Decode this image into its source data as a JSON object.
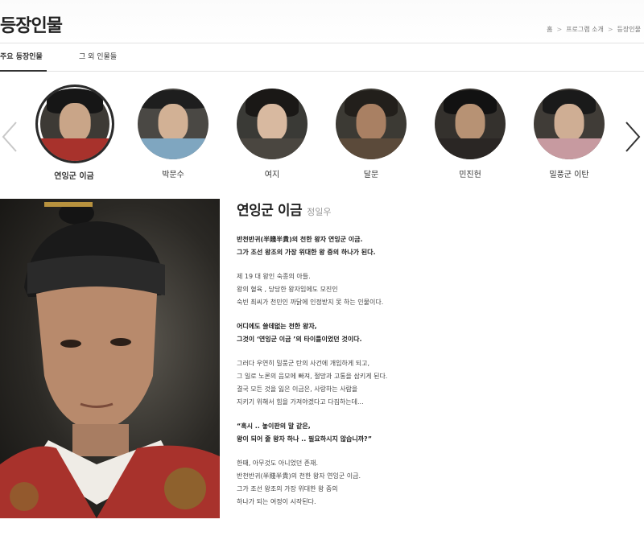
{
  "header": {
    "title": "등장인물",
    "breadcrumb": [
      "홈",
      "프로그램 소개",
      "등장인물"
    ],
    "breadcrumb_separator": ">"
  },
  "tabs": [
    {
      "label": "주요 등장인물",
      "active": true
    },
    {
      "label": "그 외 인물들",
      "active": false
    }
  ],
  "cast": [
    {
      "name": "연잉군 이금",
      "selected": true
    },
    {
      "name": "박문수",
      "selected": false
    },
    {
      "name": "여지",
      "selected": false
    },
    {
      "name": "달문",
      "selected": false
    },
    {
      "name": "민진헌",
      "selected": false
    },
    {
      "name": "밀풍군 이탄",
      "selected": false
    }
  ],
  "carousel": {
    "prev_icon": "chevron-left-icon",
    "next_icon": "chevron-right-icon"
  },
  "detail": {
    "name": "연잉군 이금",
    "actor": "정일우",
    "paragraphs": [
      {
        "bold": true,
        "lines": [
          "반천반귀(半賤半貴)의 천한 왕자 연잉군 이금.",
          "그가 조선 왕조의 가장 위대한 왕 중의 하나가 된다."
        ]
      },
      {
        "bold": false,
        "lines": [
          "제 19 대 왕인 숙종의 아들.",
          "왕의 혈육 , 당당한 왕자임에도 모진인",
          "숙빈 최씨가 천민인 까닭에 인정받지 못 하는 인물이다."
        ]
      },
      {
        "bold": true,
        "lines": [
          "어디에도 쓸데없는 천한 왕자,",
          "그것이 ‘연잉군 이금 ’의 타이틀이었던 것이다."
        ]
      },
      {
        "bold": false,
        "lines": [
          "그러다 우연히 밀풍군 탄의 사건에 개입하게 되고,",
          "그 일로 노론의 음모에 빠져, 절망과 고통을 삼키게 된다.",
          "결국 모든 것을 잃은 이금은, 사랑하는 사람을",
          "지키기 위해서 힘을 가져야겠다고 다짐하는데..."
        ]
      },
      {
        "bold": true,
        "lines": [
          "“혹시 .. 놓이판의 말 같은,",
          "왕이 되어 줄 왕자 하나 .. 필요하시지 않습니까?”"
        ]
      },
      {
        "bold": false,
        "lines": [
          "한때, 아무것도 아니었던 존재.",
          "반천반귀(半賤半貴)의 천한 왕자 연잉군 이금.",
          "그가 조선 왕조의 가장 위대한 왕 중의",
          "하나가 되는 여정이 시작된다."
        ]
      }
    ]
  },
  "colors": {
    "text": "#333333",
    "border": "#e2e2e2",
    "selected_ring": "#2b2b2b",
    "robe_red": "#a8322c"
  }
}
